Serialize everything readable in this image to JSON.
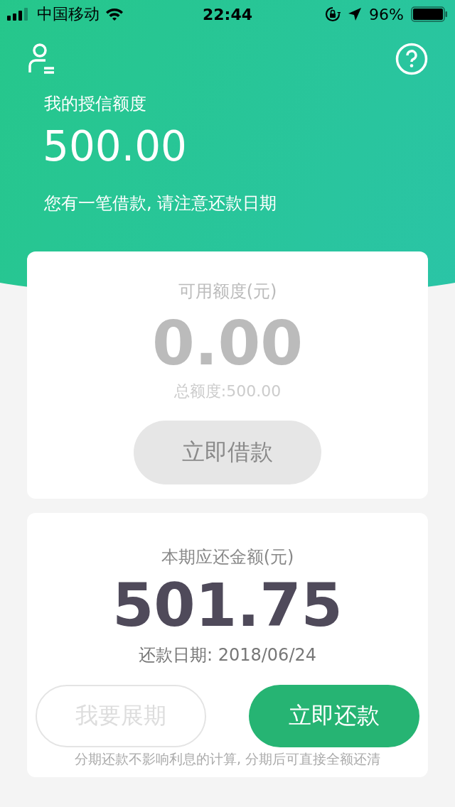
{
  "status_bar": {
    "carrier": "中国移动",
    "time": "22:44",
    "battery": "96%"
  },
  "header": {
    "title": "我的授信额度",
    "amount": "500.00",
    "notice": "您有一笔借款, 请注意还款日期"
  },
  "available_card": {
    "label": "可用额度(元)",
    "amount": "0.00",
    "total": "总额度:500.00",
    "button": {
      "label": "立即借款",
      "disabled": true
    }
  },
  "repayment_card": {
    "label": "本期应还金额(元)",
    "amount": "501.75",
    "due_date": "还款日期: 2018/06/24",
    "buttons": [
      {
        "label": "我要展期",
        "kind": "outline",
        "disabled": true
      },
      {
        "label": "立即还款",
        "kind": "filled",
        "disabled": false
      }
    ],
    "note": "分期还款不影响利息的计算, 分期后可直接全额还清"
  }
}
